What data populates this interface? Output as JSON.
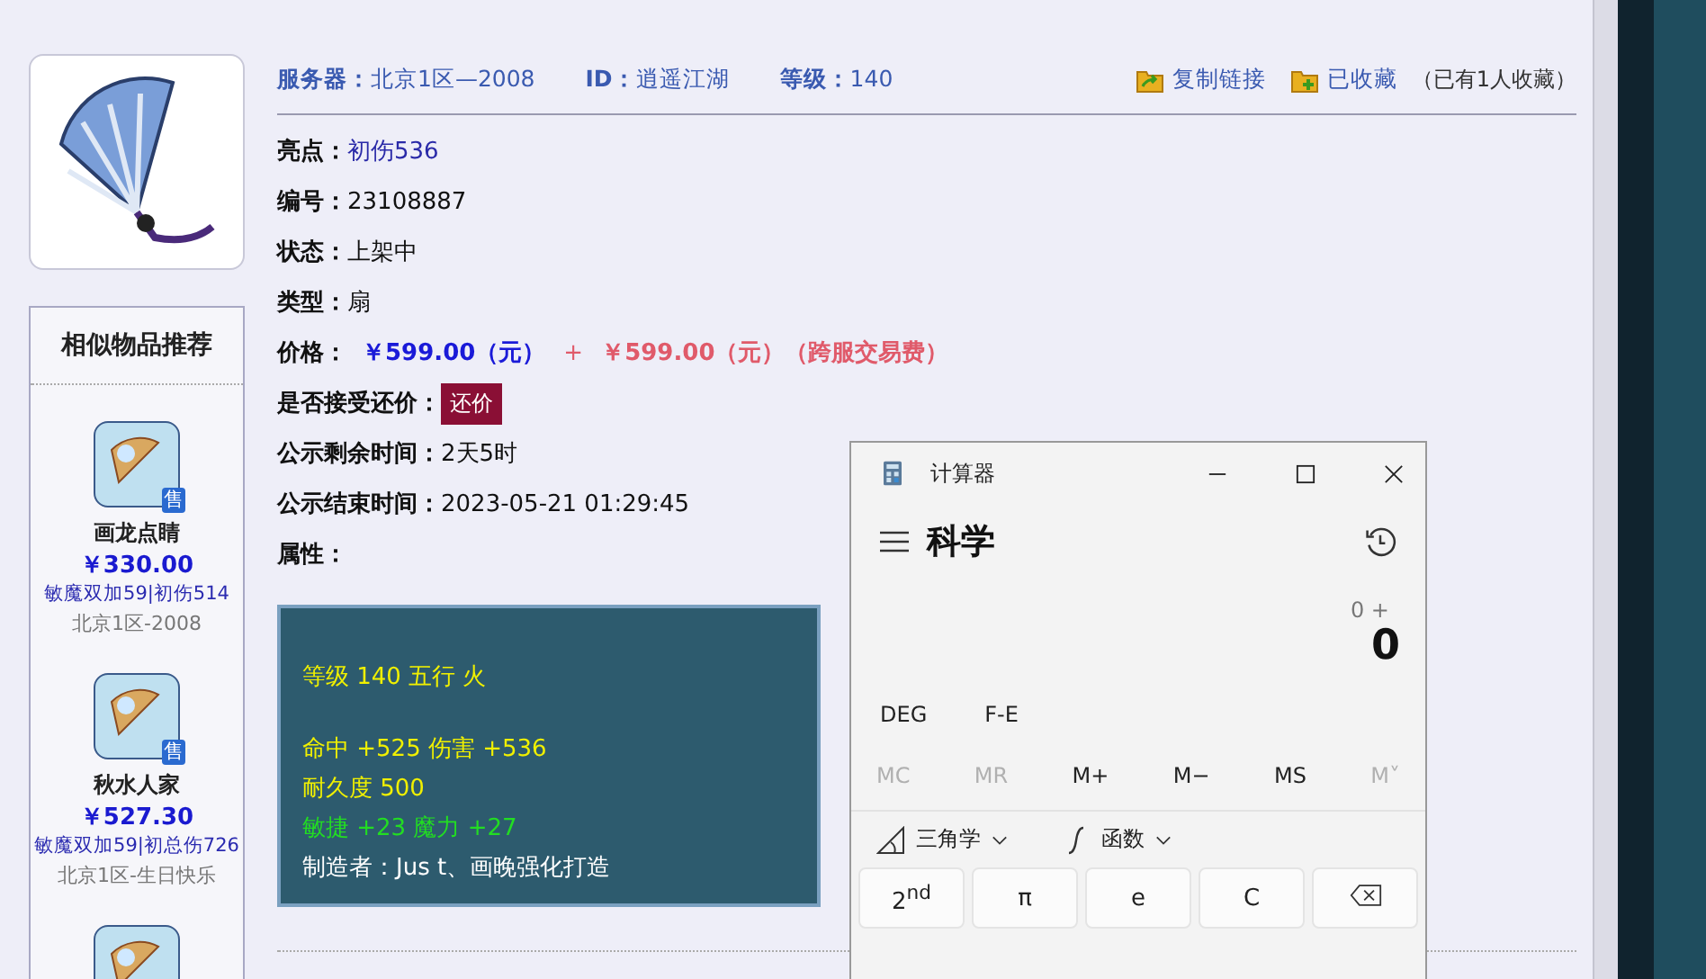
{
  "item_image": {
    "kind": "fan"
  },
  "sidebar": {
    "title": "相似物品推荐",
    "items": [
      {
        "kind": "fan",
        "badge": "售",
        "name": "画龙点睛",
        "price": "￥330.00",
        "tags": "敏魔双加59|初伤514",
        "server": "北京1区-2008"
      },
      {
        "kind": "fan",
        "badge": "售",
        "name": "秋水人家",
        "price": "￥527.30",
        "tags": "敏魔双加59|初总伤726",
        "server": "北京1区-生日快乐"
      },
      {
        "kind": "fan"
      }
    ]
  },
  "header": {
    "fields": [
      {
        "label": "服务器：",
        "value": "北京1区—2008"
      },
      {
        "label": "ID：",
        "value": "逍遥江湖"
      },
      {
        "label": "等级：",
        "value": "140"
      }
    ],
    "actions": [
      {
        "kind": "share",
        "label": "复制链接"
      },
      {
        "kind": "favorite",
        "label": "已收藏"
      }
    ],
    "favorite_note": "（已有1人收藏）"
  },
  "details": [
    {
      "kind": "link",
      "label": "亮点：",
      "value": "初伤536"
    },
    {
      "kind": "text",
      "label": "编号：",
      "value": "23108887"
    },
    {
      "kind": "text",
      "label": "状态：",
      "value": "上架中"
    },
    {
      "kind": "text",
      "label": "类型：",
      "value": "扇"
    },
    {
      "kind": "price",
      "label": "价格：",
      "value": "￥599.00（元）",
      "plus": "+",
      "extra": "￥599.00（元）（跨服交易费）"
    },
    {
      "kind": "button",
      "label": "是否接受还价：",
      "value": "还价"
    },
    {
      "kind": "text",
      "label": "公示剩余时间：",
      "value": "2天5时"
    },
    {
      "kind": "text",
      "label": "公示结束时间：",
      "value": "2023-05-21 01:29:45"
    },
    {
      "kind": "heading",
      "label": "属性："
    }
  ],
  "attributes": {
    "groups": [
      {
        "lines": [
          {
            "text": "等级 140 五行 火",
            "color": "#f0f000"
          }
        ]
      },
      {
        "lines": [
          {
            "text": "命中 +525 伤害 +536",
            "color": "#f0f000"
          },
          {
            "text": "耐久度 500",
            "color": "#f0f000"
          },
          {
            "text": "敏捷 +23 魔力 +27",
            "color": "#22dd22"
          },
          {
            "text": "制造者：Jus t、画晚强化打造",
            "color": "#ffffff"
          }
        ]
      }
    ]
  },
  "calculator": {
    "title": "计算器",
    "mode": "科学",
    "expression": "0 +",
    "display": "0",
    "toggles": [
      "DEG",
      "F-E"
    ],
    "memory": [
      {
        "label": "MC",
        "disabled": true
      },
      {
        "label": "MR",
        "disabled": true
      },
      {
        "label": "M+",
        "disabled": false
      },
      {
        "label": "M−",
        "disabled": false
      },
      {
        "label": "MS",
        "disabled": false
      },
      {
        "label": "M˅",
        "disabled": true
      }
    ],
    "dropdowns": [
      {
        "kind": "trig",
        "label": "三角学"
      },
      {
        "kind": "func",
        "label": "函数"
      }
    ],
    "keys": [
      {
        "kind": "text",
        "label": "2$^{nd}$"
      },
      {
        "kind": "text",
        "label": "π"
      },
      {
        "kind": "text",
        "label": "e"
      },
      {
        "kind": "text",
        "label": "C"
      },
      {
        "kind": "backspace"
      }
    ]
  }
}
